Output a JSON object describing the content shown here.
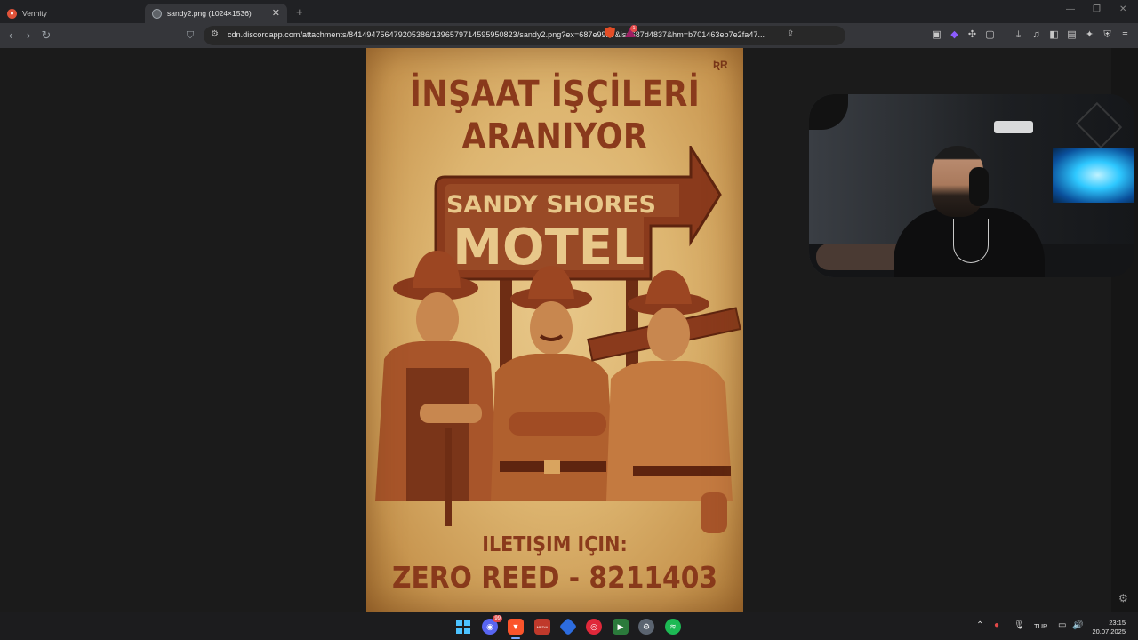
{
  "browser": {
    "tabs": [
      {
        "title": "Vennity"
      },
      {
        "title": "sandy2.png (1024×1536)",
        "close": "✕"
      }
    ],
    "new_tab": "+",
    "window_controls": {
      "minimize": "—",
      "maximize": "❐",
      "close": "✕"
    },
    "nav": {
      "back": "‹",
      "forward": "›",
      "reload": "↻",
      "bookmark": "⛉"
    },
    "address": {
      "url": "cdn.discordapp.com/attachments/841494756479205386/1396579714595950823/sandy2.png?ex=687e99b7&is=687d4837&hm=b701463eb7e2fa47...",
      "rewards_count": "1"
    },
    "extensions": [
      "hd-icon",
      "gamepad-icon",
      "puzzle-icon",
      "screenshot-icon",
      "download-icon",
      "music-icon",
      "sidebar-icon",
      "wallet-icon",
      "sparkle-icon",
      "shield-icon",
      "menu-icon"
    ]
  },
  "poster": {
    "title_line1": "İNŞAAT İŞÇİLERİ",
    "title_line2": "ARANIYOR",
    "sign_line1": "SANDY SHORES",
    "sign_line2": "MOTEL",
    "contact_label": "ILETIŞIM IÇIN:",
    "contact_value": "ZERO REED - 8211403",
    "logo": "ƦR",
    "colors": {
      "ink": "#8a3a1c",
      "paper": "#e2bf7e",
      "dark": "#6e2d14"
    }
  },
  "taskbar": {
    "apps": [
      "windows-start-icon",
      "discord-icon",
      "brave-icon",
      "stream-app-icon",
      "pixel-app-icon",
      "opera-gx-icon",
      "spotify-icon",
      "settings-icon",
      "music-app-icon"
    ],
    "discord_badge": "99",
    "stream_app_label": "MEDIA",
    "language": "TUR",
    "time": "23:15",
    "date": "20.07.2025"
  }
}
